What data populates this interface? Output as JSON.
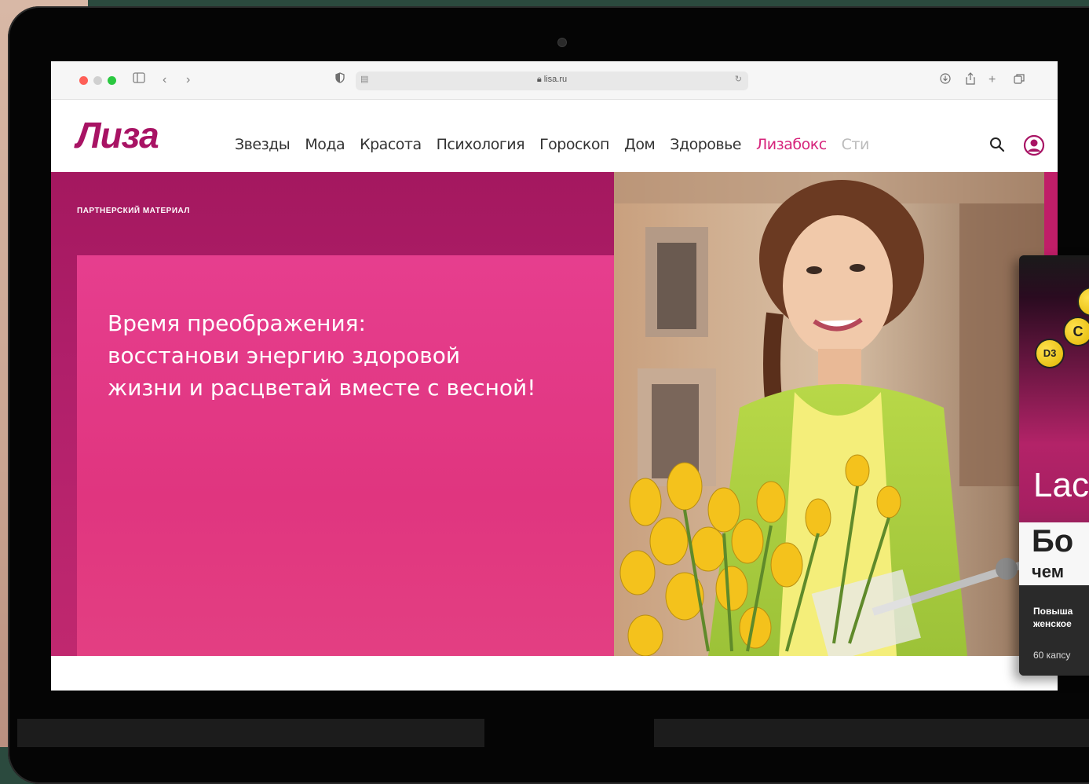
{
  "browser": {
    "url": "lisa.ru"
  },
  "site": {
    "logo": "Лиза",
    "nav": [
      {
        "label": "Звезды",
        "accent": false
      },
      {
        "label": "Мода",
        "accent": false
      },
      {
        "label": "Красота",
        "accent": false
      },
      {
        "label": "Психология",
        "accent": false
      },
      {
        "label": "Гороскоп",
        "accent": false
      },
      {
        "label": "Дом",
        "accent": false
      },
      {
        "label": "Здоровье",
        "accent": false
      },
      {
        "label": "Лизабокс",
        "accent": true
      },
      {
        "label": "Сти",
        "accent": false
      }
    ],
    "accent_color": "#d6247b",
    "logo_color": "#a81364"
  },
  "hero": {
    "tag": "ПАРТНЕРСКИЙ МАТЕРИАЛ",
    "headline_lines": [
      "Время преображения:",
      "восстанови энергию здоровой",
      "жизни и расцветай вместе с весной!"
    ]
  },
  "product": {
    "vitamins": [
      "C",
      "D3"
    ],
    "brand": "Lac",
    "title": "Бо",
    "subtitle": "чем",
    "desc_line1": "Повыша",
    "desc_line2": "женское",
    "count": "60 капсу"
  }
}
